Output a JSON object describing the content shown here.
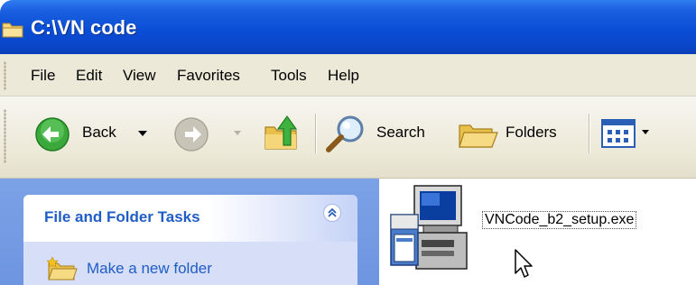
{
  "window": {
    "title": "C:\\VN code",
    "title_color": "#0a4ed6"
  },
  "menu": {
    "items": [
      "File",
      "Edit",
      "View",
      "Favorites",
      "Tools",
      "Help"
    ]
  },
  "toolbar": {
    "back_label": "Back",
    "search_label": "Search",
    "folders_label": "Folders",
    "icons": [
      "back-arrow-icon",
      "forward-arrow-icon",
      "folder-up-icon",
      "search-magnifier-icon",
      "folders-icon",
      "views-icon"
    ]
  },
  "tasks": {
    "header": "File and Folder Tasks",
    "items": [
      {
        "label": "Make a new folder",
        "icon": "new-folder-icon"
      }
    ],
    "header_color": "#215dc6"
  },
  "files": [
    {
      "name": "VNCode_b2_setup.exe",
      "icon": "setup-installer-icon"
    }
  ]
}
